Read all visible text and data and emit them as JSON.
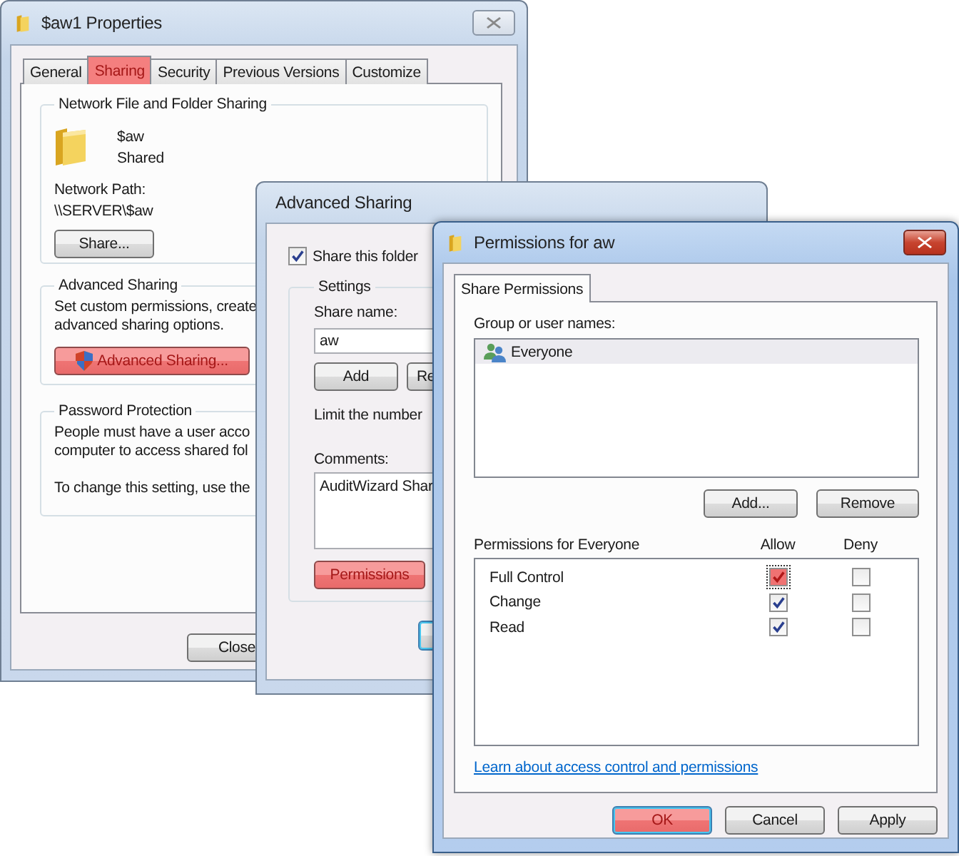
{
  "properties_dialog": {
    "title": "$aw1 Properties",
    "tabs": [
      {
        "label": "General",
        "selected": false
      },
      {
        "label": "Sharing",
        "selected": true
      },
      {
        "label": "Security",
        "selected": false
      },
      {
        "label": "Previous Versions",
        "selected": false
      },
      {
        "label": "Customize",
        "selected": false
      }
    ],
    "network_sharing": {
      "title": "Network File and Folder Sharing",
      "folder_name": "$aw",
      "status": "Shared",
      "path_label": "Network Path:",
      "path": "\\\\SERVER\\$aw",
      "button": "Share..."
    },
    "advanced_sharing": {
      "title": "Advanced Sharing",
      "description": [
        "Set custom permissions, create",
        "advanced sharing options."
      ],
      "button": {
        "label": "Advanced Sharing...",
        "highlighted": true
      }
    },
    "password_protection": {
      "title": "Password Protection",
      "lines": [
        "People must have a user acco",
        "computer to access shared fol"
      ],
      "note": "To change this setting, use the"
    },
    "buttons": [
      "Close"
    ]
  },
  "advanced_sharing_dialog": {
    "title": "Advanced Sharing",
    "share_checkbox": {
      "label": "Share this folder",
      "checked": true
    },
    "settings": {
      "title": "Settings",
      "share_name_label": "Share name:",
      "share_name": "aw",
      "buttons": [
        "Add",
        "Re"
      ],
      "limit_text": "Limit the number",
      "comments_label": "Comments:",
      "comments": "AuditWizard Shar",
      "permissions_button": {
        "label": "Permissions",
        "highlighted": true
      }
    }
  },
  "permissions_dialog": {
    "title": "Permissions for aw",
    "tabs": [
      {
        "label": "Share Permissions",
        "selected": true
      }
    ],
    "users_label": "Group or user names:",
    "users": [
      {
        "name": "Everyone",
        "selected": true
      }
    ],
    "user_buttons": [
      "Add...",
      "Remove"
    ],
    "permissions_label": "Permissions for Everyone",
    "columns": [
      "Allow",
      "Deny"
    ],
    "permissions": [
      {
        "name": "Full Control",
        "allow": {
          "checked": true,
          "highlighted": true
        },
        "deny": {
          "checked": false
        }
      },
      {
        "name": "Change",
        "allow": {
          "checked": true,
          "highlighted": false
        },
        "deny": {
          "checked": false
        }
      },
      {
        "name": "Read",
        "allow": {
          "checked": true,
          "highlighted": false
        },
        "deny": {
          "checked": false
        }
      }
    ],
    "link": "Learn about access control and permissions",
    "buttons": [
      {
        "label": "OK",
        "highlighted": true
      },
      {
        "label": "Cancel",
        "highlighted": false
      },
      {
        "label": "Apply",
        "highlighted": false
      }
    ]
  }
}
